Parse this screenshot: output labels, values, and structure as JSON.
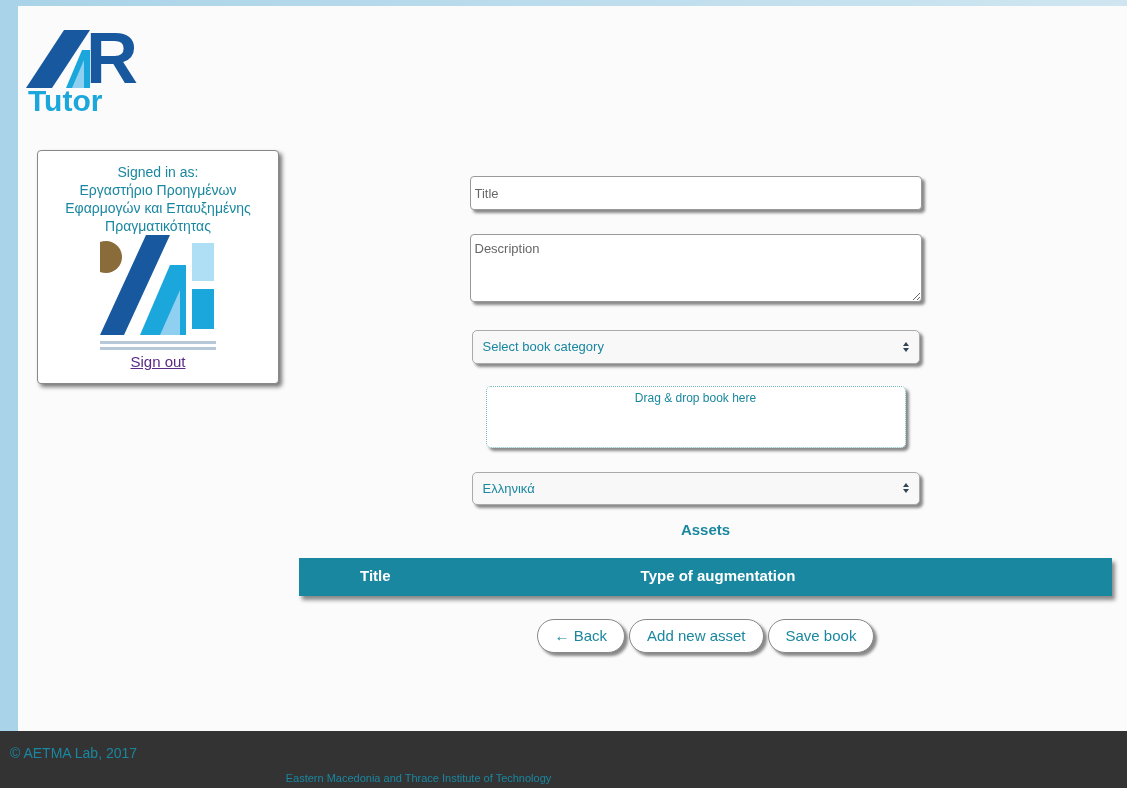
{
  "logo": {
    "letter": "R",
    "word": "Tutor"
  },
  "user_card": {
    "label": "Signed in as:",
    "name": "Εργαστήριο Προηγμένων Εφαρμογών και Επαυξημένης Πραγματικότητας",
    "sign_out": "Sign out"
  },
  "form": {
    "title": {
      "placeholder": "Title"
    },
    "description": {
      "placeholder": "Description"
    },
    "category": {
      "value": "Select book category"
    },
    "dropzone": "Drag & drop book here",
    "language": {
      "value": "Ελληνικά"
    }
  },
  "assets": {
    "heading": "Assets",
    "columns": [
      "Title",
      "Type of augmentation"
    ]
  },
  "buttons": [
    {
      "label": "← Back"
    },
    {
      "label": "Add new asset"
    },
    {
      "label": "Save book"
    }
  ],
  "footer": {
    "copyright": "© AETMA Lab, 2017",
    "institute": "Eastern Macedonia and Thrace Institute of Technology"
  }
}
